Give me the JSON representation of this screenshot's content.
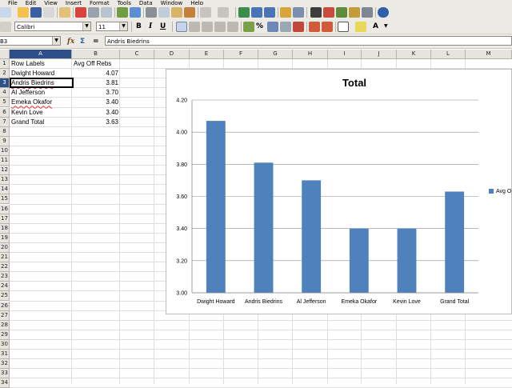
{
  "menu": [
    "File",
    "Edit",
    "View",
    "Insert",
    "Format",
    "Tools",
    "Data",
    "Window",
    "Help"
  ],
  "format_toolbar": {
    "font": "Calibri",
    "size": "11"
  },
  "formula_bar": {
    "name_box": "B3",
    "content": "Andris Biedrins"
  },
  "columns": [
    "A",
    "B",
    "C",
    "D",
    "E",
    "F",
    "G",
    "H",
    "I",
    "J",
    "K",
    "L",
    "M"
  ],
  "rows": [
    "1",
    "2",
    "3",
    "4",
    "5",
    "6",
    "7",
    "8",
    "9",
    "10",
    "11",
    "12",
    "13",
    "14",
    "15",
    "16",
    "17",
    "18",
    "19",
    "20",
    "21",
    "22",
    "23",
    "24",
    "25",
    "26",
    "27",
    "28",
    "29",
    "30",
    "31",
    "32",
    "33",
    "34"
  ],
  "table": {
    "header": {
      "label": "Row Labels",
      "value": "Avg Off Rebs"
    },
    "rows": [
      {
        "label": "Dwight Howard",
        "value": "4.07"
      },
      {
        "label": "Andris Biedrins",
        "value": "3.81"
      },
      {
        "label": "Al Jefferson",
        "value": "3.70"
      },
      {
        "label": "Emeka Okafor",
        "value": "3.40"
      },
      {
        "label": "Kevin Love",
        "value": "3.40"
      },
      {
        "label": "Grand Total",
        "value": "3.63"
      }
    ]
  },
  "chart_data": {
    "type": "bar",
    "title": "Total",
    "categories": [
      "Dwight Howard",
      "Andris Biedrins",
      "Al Jefferson",
      "Emeka Okafor",
      "Kevin Love",
      "Grand Total"
    ],
    "series": [
      {
        "name": "Avg Off Rebs",
        "values": [
          4.07,
          3.81,
          3.7,
          3.4,
          3.4,
          3.63
        ],
        "color": "#4f81bd"
      }
    ],
    "yticks": [
      "3.00",
      "3.20",
      "3.40",
      "3.60",
      "3.80",
      "4.00",
      "4.20"
    ],
    "ylim": [
      3.0,
      4.2
    ],
    "grid": true,
    "legend_position": "right",
    "legend_label": "Avg O"
  }
}
